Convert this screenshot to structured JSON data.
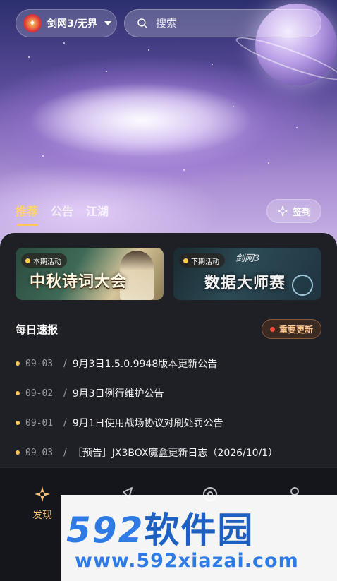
{
  "header": {
    "game_selector": {
      "label": "剑网3/无界",
      "logo_glyph": "✦"
    },
    "search": {
      "placeholder": "搜索"
    }
  },
  "tabs": [
    {
      "label": "推荐",
      "active": true
    },
    {
      "label": "公告",
      "active": false
    },
    {
      "label": "江湖",
      "active": false
    }
  ],
  "signin": {
    "label": "签到"
  },
  "banners": [
    {
      "badge": "本期活动",
      "title": "中秋诗词大会"
    },
    {
      "badge": "下期活动",
      "title": "数据大师赛",
      "logo_text": "剑网3"
    }
  ],
  "daily_news": {
    "title": "每日速报",
    "important_label": "重要更新",
    "items": [
      {
        "date": "09-03",
        "title": "9月3日1.5.0.9948版本更新公告"
      },
      {
        "date": "09-02",
        "title": "9月3日例行维护公告"
      },
      {
        "date": "09-01",
        "title": "9月1日使用战场协议对刷处罚公告"
      },
      {
        "date": "09-03",
        "title": "［预告］JX3BOX魔盒更新日志（2026/10/1）"
      }
    ]
  },
  "bottom_nav": {
    "items": [
      {
        "label": "发现",
        "icon": "discover-icon",
        "active": true
      },
      {
        "label": "",
        "icon": "rocket-icon",
        "active": false
      },
      {
        "label": "",
        "icon": "compass-icon",
        "active": false
      },
      {
        "label": "",
        "icon": "profile-icon",
        "active": false
      }
    ]
  },
  "watermark": {
    "brand": "592",
    "brand_cn": "软件园",
    "url": "www.592xiazai.com"
  },
  "colors": {
    "accent": "#ffc857",
    "panel": "#1f2026",
    "nav": "#15161b",
    "alert": "#ff4a3a"
  }
}
